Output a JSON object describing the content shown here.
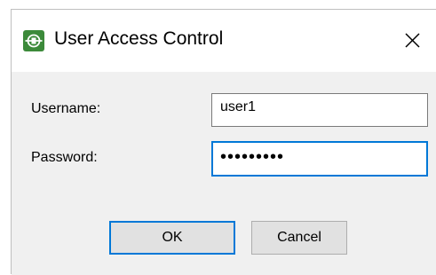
{
  "window": {
    "title": "User Access Control",
    "app_icon": "network-plug-icon",
    "close_icon": "close-icon"
  },
  "form": {
    "username_label": "Username:",
    "username_value": "user1",
    "password_label": "Password:",
    "password_value": "•••••••••"
  },
  "buttons": {
    "ok_label": "OK",
    "cancel_label": "Cancel"
  },
  "colors": {
    "accent": "#0078d7",
    "icon_green": "#3c8a3a",
    "body_background": "#f0f0f0"
  }
}
